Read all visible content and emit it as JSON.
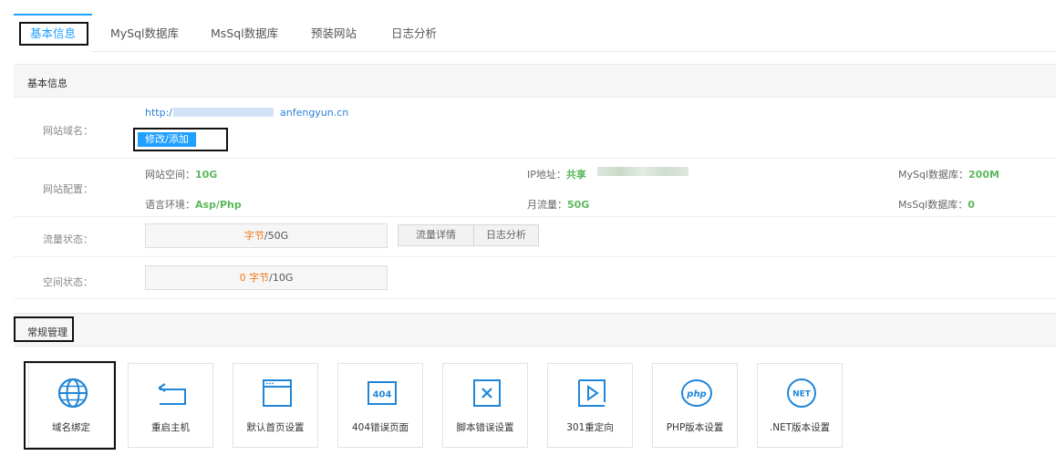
{
  "tabs": [
    {
      "label": "基本信息"
    },
    {
      "label": "MySql数据库"
    },
    {
      "label": "MsSql数据库"
    },
    {
      "label": "预装网站"
    },
    {
      "label": "日志分析"
    }
  ],
  "basic": {
    "section_title": "基本信息",
    "domain_label": "网站域名：",
    "domain_prefix": "http:/",
    "domain_suffix": "anfengyun.cn",
    "modify_button": "修改/添加",
    "config_label": "网站配置：",
    "space_label": "网站空间：",
    "space_value": "10G",
    "lang_label": "语言环境：",
    "lang_value": "Asp/Php",
    "ip_label": "IP地址：",
    "ip_value": "共享",
    "traffic_label": "月流量：",
    "traffic_value": "50G",
    "mysql_label": "MySql数据库：",
    "mysql_value": "200M",
    "mssql_label": "MsSql数据库：",
    "mssql_value": "0",
    "flow_label": "流量状态：",
    "flow_unit": "字节",
    "flow_total": "/50G",
    "flow_detail_button": "流量详情",
    "log_button": "日志分析",
    "disk_label": "空间状态：",
    "disk_used": "0",
    "disk_unit": "字节",
    "disk_total": "/10G"
  },
  "manage": {
    "section_title": "常规管理",
    "cards": [
      {
        "label": "域名绑定",
        "icon": "globe-icon"
      },
      {
        "label": "重启主机",
        "icon": "restart-icon"
      },
      {
        "label": "默认首页设置",
        "icon": "browser-window-icon"
      },
      {
        "label": "404错误页面",
        "icon": "404-icon",
        "glyph": "404"
      },
      {
        "label": "脚本错误设置",
        "icon": "close-box-icon"
      },
      {
        "label": "301重定向",
        "icon": "play-box-icon"
      },
      {
        "label": "PHP版本设置",
        "icon": "php-icon",
        "glyph": "php"
      },
      {
        "label": ".NET版本设置",
        "icon": "net-icon",
        "glyph": "NET"
      }
    ]
  },
  "colors": {
    "accent": "#20a0ff",
    "value_green": "#5cb85c",
    "orange": "#f07818",
    "icon_blue": "#1f86d8"
  }
}
